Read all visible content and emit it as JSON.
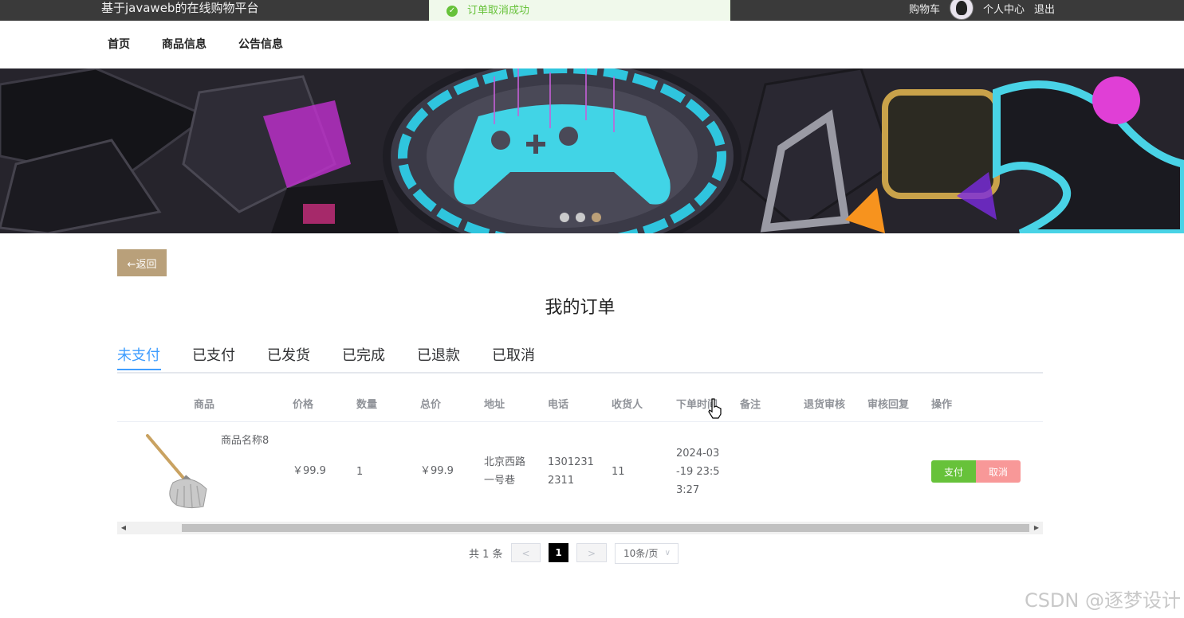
{
  "header": {
    "brand": "基于javaweb的在线购物平台",
    "cart_label": "购物车",
    "profile_label": "个人中心",
    "logout_label": "退出"
  },
  "toast": {
    "message": "订单取消成功"
  },
  "nav": {
    "items": [
      "首页",
      "商品信息",
      "公告信息"
    ]
  },
  "banner": {
    "dots": 3,
    "active_dot": 3
  },
  "back_button": "←返回",
  "page_title": "我的订单",
  "tabs": [
    "未支付",
    "已支付",
    "已发货",
    "已完成",
    "已退款",
    "已取消"
  ],
  "active_tab": 0,
  "table": {
    "columns": [
      "商品",
      "价格",
      "数量",
      "总价",
      "地址",
      "电话",
      "收货人",
      "下单时间",
      "备注",
      "退货审核",
      "审核回复",
      "操作"
    ],
    "rows": [
      {
        "product_name": "商品名称8",
        "price": "￥99.9",
        "quantity": "1",
        "total": "￥99.9",
        "address_line1": "北京西路",
        "address_line2": "一号巷",
        "phone_line1": "1301231",
        "phone_line2": "2311",
        "receiver": "11",
        "time_line1": "2024-03",
        "time_line2": "-19 23:5",
        "time_line3": "3:27",
        "remark": "",
        "return_review": "",
        "review_reply": "",
        "pay_label": "支付",
        "cancel_label": "取消"
      }
    ]
  },
  "pagination": {
    "total_text": "共 1 条",
    "prev": "<",
    "current": "1",
    "next": ">",
    "page_size": "10条/页"
  },
  "watermark": "CSDN @逐梦设计",
  "colors": {
    "topbar": "#3a3a3a",
    "accent_tab": "#409eff",
    "back_button": "#b9a07a",
    "pay_button": "#67c23a",
    "cancel_button": "#f89898",
    "toast_bg": "#f0f9eb"
  }
}
